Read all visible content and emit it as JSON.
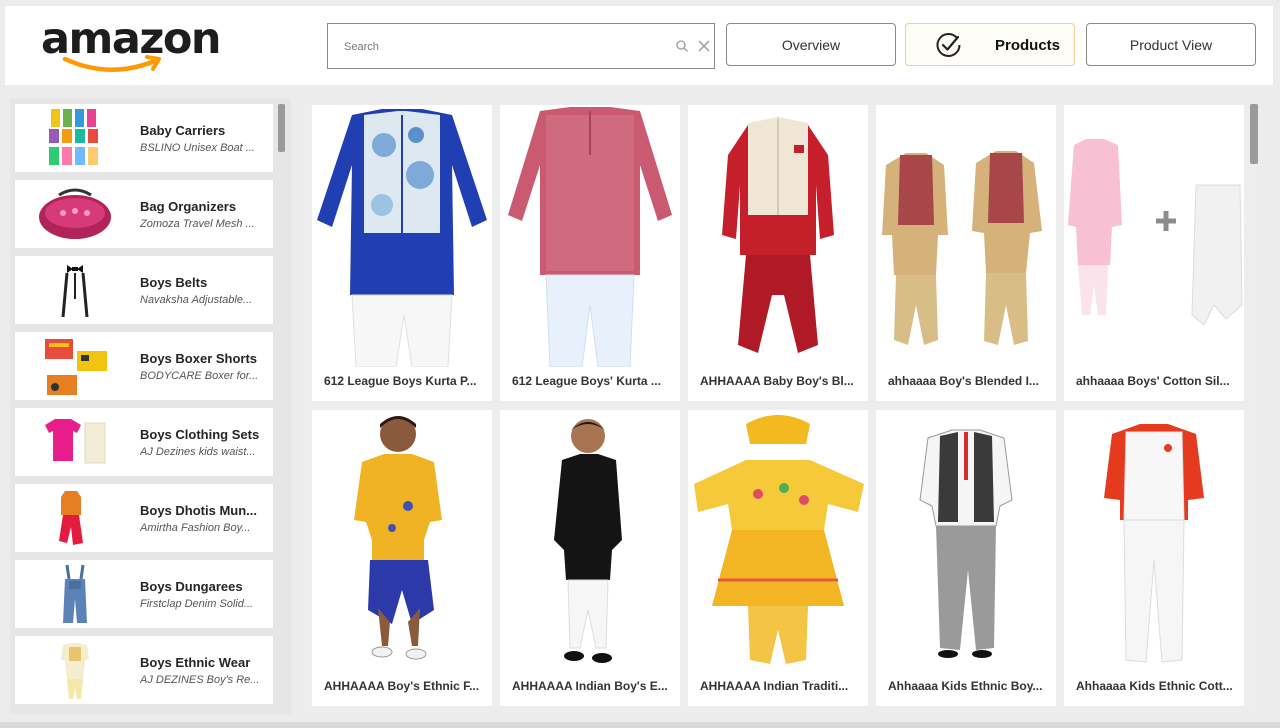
{
  "brand": {
    "logo_text": "amazon",
    "accent": "#ff9900"
  },
  "search": {
    "placeholder": "Search",
    "value": ""
  },
  "nav": {
    "overview": "Overview",
    "products": "Products",
    "product_view": "Product View",
    "active": "Products",
    "active_border": "#f1cf8f"
  },
  "sidebar": {
    "items": [
      {
        "title": "Baby Carriers",
        "sub": "BSLINO Unisex Boat ..."
      },
      {
        "title": "Bag Organizers",
        "sub": "Zomoza Travel Mesh ..."
      },
      {
        "title": "Boys Belts",
        "sub": "Navaksha Adjustable..."
      },
      {
        "title": "Boys Boxer Shorts",
        "sub": "BODYCARE Boxer for..."
      },
      {
        "title": "Boys Clothing Sets",
        "sub": "AJ Dezines kids waist..."
      },
      {
        "title": "Boys Dhotis Mun...",
        "sub": "Amirtha Fashion Boy..."
      },
      {
        "title": "Boys Dungarees",
        "sub": "Firstclap Denim Solid..."
      },
      {
        "title": "Boys Ethnic Wear",
        "sub": "AJ DEZINES Boy's Re..."
      }
    ]
  },
  "products": [
    {
      "name": "612 League Boys Kurta P..."
    },
    {
      "name": "612 League Boys' Kurta ..."
    },
    {
      "name": "AHHAAAA Baby Boy's Bl..."
    },
    {
      "name": "ahhaaaa Boy's Blended I..."
    },
    {
      "name": "ahhaaaa Boys' Cotton Sil..."
    },
    {
      "name": "AHHAAAA Boy's Ethnic F..."
    },
    {
      "name": "AHHAAAA Indian Boy's E..."
    },
    {
      "name": "AHHAAAA Indian Traditi..."
    },
    {
      "name": "Ahhaaaa Kids Ethnic Boy..."
    },
    {
      "name": "Ahhaaaa Kids Ethnic Cott..."
    }
  ]
}
